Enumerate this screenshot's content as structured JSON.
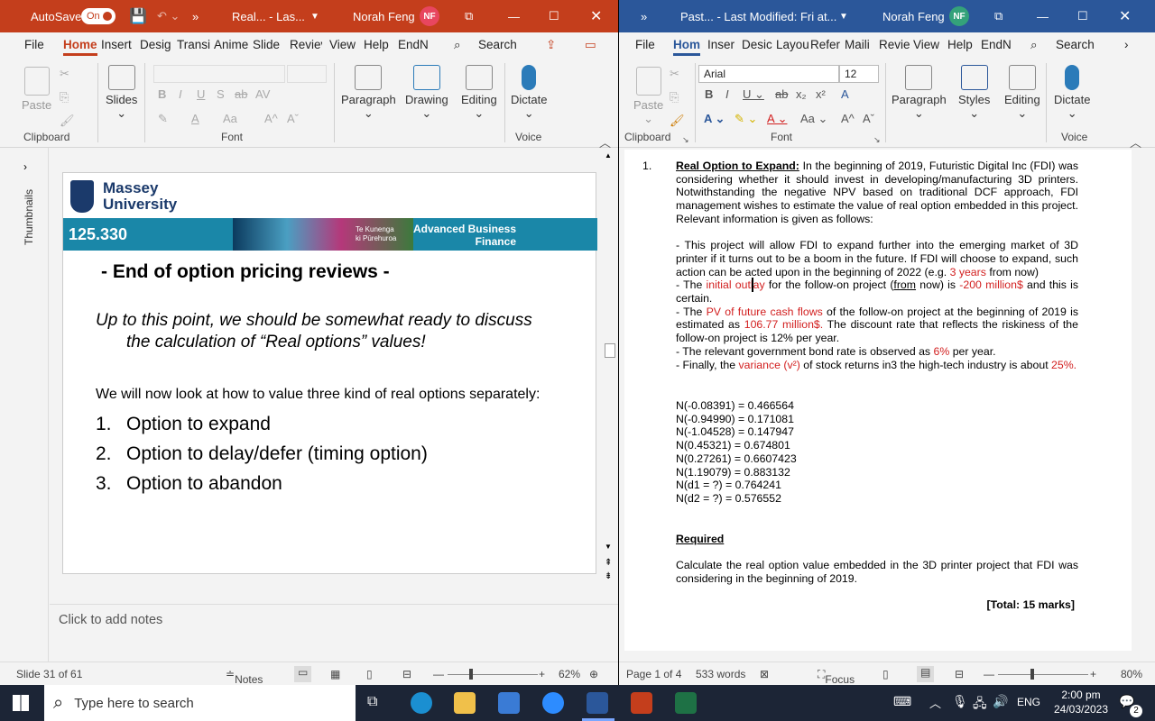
{
  "ppt": {
    "autosave": "AutoSave",
    "autosave_state": "On",
    "title": "Real...  -  Las...",
    "user": "Norah Feng",
    "initials": "NF",
    "tabs": [
      "File",
      "Home",
      "Insert",
      "Desig",
      "Transi",
      "Anime",
      "Slide",
      "Reviev",
      "View",
      "Help",
      "EndN"
    ],
    "search": "Search",
    "groups": {
      "clipboard": "Clipboard",
      "font": "Font",
      "voice": "Voice"
    },
    "buttons": {
      "paste": "Paste",
      "slides": "Slides",
      "paragraph": "Paragraph",
      "drawing": "Drawing",
      "editing": "Editing",
      "dictate": "Dictate"
    },
    "thumbnails": "Thumbnails",
    "slide": {
      "logo_line1": "Massey",
      "logo_line2": "University",
      "course": "125.330",
      "maori_line1": "Te Kunenga",
      "maori_line2": "ki Pūrehuroa",
      "banner_line1": "Advanced Business",
      "banner_line2": "Finance",
      "heading": "- End of option pricing reviews -",
      "italic_line1": "Up to this point, we should be somewhat ready to discuss",
      "italic_line2": "the calculation of “Real options” values!",
      "intro": "We will now look at how to value three kind of real options separately:",
      "list": [
        {
          "n": "1.",
          "t": "Option to expand"
        },
        {
          "n": "2.",
          "t": "Option to delay/defer (timing option)"
        },
        {
          "n": "3.",
          "t": "Option to abandon"
        }
      ]
    },
    "notes": "Click to add notes",
    "status": {
      "slide": "Slide 31 of 61",
      "notes": "Notes",
      "zoom": "62%"
    }
  },
  "word": {
    "title": "Past...  -  Last Modified: Fri at...",
    "user": "Norah Feng",
    "initials": "NF",
    "tabs": [
      "File",
      "Hom",
      "Inser",
      "Desic",
      "Layou",
      "Refer",
      "Maili",
      "Revie",
      "View",
      "Help",
      "EndN"
    ],
    "search": "Search",
    "font_name": "Arial",
    "font_size": "12",
    "groups": {
      "clipboard": "Clipboard",
      "font": "Font",
      "voice": "Voice"
    },
    "buttons": {
      "paste": "Paste",
      "paragraph": "Paragraph",
      "styles": "Styles",
      "editing": "Editing",
      "dictate": "Dictate"
    },
    "doc": {
      "num": "1.",
      "heading": "Real Option to Expand:",
      "p1": "In the beginning of 2019, Futuristic Digital Inc (FDI) was considering whether it should invest in developing/manufacturing 3D printers. Notwithstanding the negative NPV based on traditional DCF approach, FDI management wishes to estimate the value of real option embedded in this project. Relevant information is given as follows:",
      "b1a": "- This project will allow FDI to expand further into the emerging market of 3D printer if it turns out to be a boom in the future. If FDI will choose to expand, such action can be acted upon in the beginning of 2022 (e.g.",
      "b1r": "3 years",
      "b1b": "from now)",
      "b2a": "- The",
      "b2r": "initial outlay",
      "b2b": "for the follow-on project (",
      "b2u": "from",
      "b2c": "now) is",
      "b2r2": "-200 million$",
      "b2d": "and this is certain.",
      "b3a": "- The",
      "b3r": "PV of future cash flows",
      "b3b": "of the follow-on project at the beginning of 2019 is estimated as",
      "b3r2": "106.77 million$.",
      "b3c": "The discount rate that reflects the riskiness of the follow-on project is 12% per year.",
      "b4a": "- The relevant government bond rate is observed as",
      "b4r": "6%",
      "b4b": "per year.",
      "b5a": "- Finally, the",
      "b5r": "variance (v²)",
      "b5b": "of stock returns in3 the high-tech industry is about",
      "b5r2": "25%.",
      "n_values": [
        "N(-0.08391) = 0.466564",
        "N(-0.94990) = 0.171081",
        "N(-1.04528) = 0.147947",
        "N(0.45321) =  0.674801",
        "N(0.27261) = 0.6607423",
        "N(1.19079) = 0.883132",
        "N(d1 = ?) = 0.764241",
        "N(d2 = ?) = 0.576552"
      ],
      "required": "Required",
      "req_text": "Calculate the real option value embedded in the 3D printer project that FDI was considering in the beginning of 2019.",
      "total": "[Total: 15 marks]"
    },
    "status": {
      "page": "Page 1 of 4",
      "words": "533 words",
      "focus": "Focus",
      "zoom": "80%"
    }
  },
  "taskbar": {
    "search": "Type here to search",
    "lang": "ENG",
    "time": "2:00 pm",
    "date": "24/03/2023",
    "notif": "2"
  }
}
